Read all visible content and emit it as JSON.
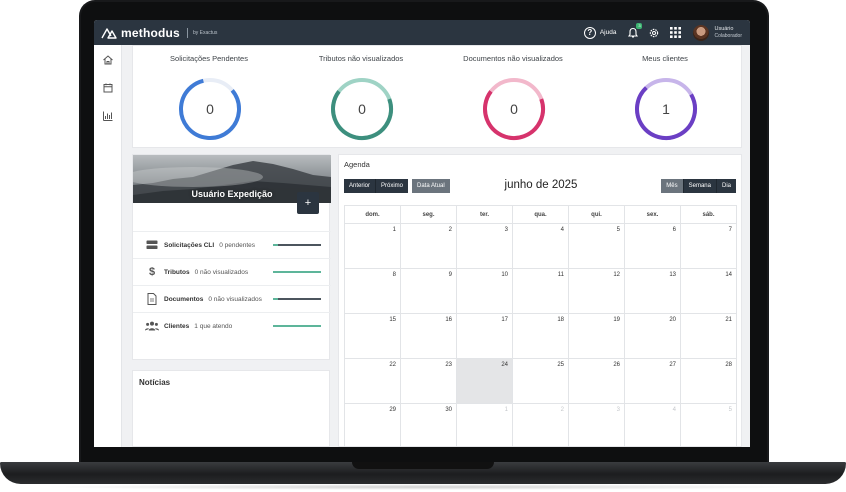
{
  "app": {
    "brand": "methodus",
    "brand_by": "by Exactus",
    "help_label": "Ajuda",
    "notification_count": "3",
    "user_name": "Usuário",
    "user_role": "Colaborador"
  },
  "stats": [
    {
      "title": "Solicitações Pendentes",
      "value": "0",
      "color": "#3f7bd6"
    },
    {
      "title": "Tributos não visualizados",
      "value": "0",
      "color": "#3d8f7e"
    },
    {
      "title": "Documentos não visualizados",
      "value": "0",
      "color": "#d6336c"
    },
    {
      "title": "Meus clientes",
      "value": "1",
      "color": "#6b3fc4"
    }
  ],
  "profile": {
    "name": "Usuário Expedição",
    "plus_label": "+",
    "rows": [
      {
        "label": "Solicitações CLI",
        "count": "0 pendentes",
        "icon": "server-icon",
        "progress": 0.1
      },
      {
        "label": "Tributos",
        "count": "0 não visualizados",
        "icon": "dollar-icon",
        "progress": 1.0
      },
      {
        "label": "Documentos",
        "count": "0 não visualizados",
        "icon": "document-icon",
        "progress": 0.1
      },
      {
        "label": "Clientes",
        "count": "1 que atendo",
        "icon": "users-icon",
        "progress": 1.0
      }
    ]
  },
  "news": {
    "title": "Notícias"
  },
  "agenda": {
    "title": "Agenda",
    "prev_label": "Anterior",
    "next_label": "Próximo",
    "today_label": "Data Atual",
    "month_title": "junho de 2025",
    "view_month": "Mês",
    "view_week": "Semana",
    "view_day": "Dia",
    "weekdays": [
      "dom.",
      "seg.",
      "ter.",
      "qua.",
      "qui.",
      "sex.",
      "sáb."
    ],
    "weeks": [
      [
        {
          "d": "1"
        },
        {
          "d": "2"
        },
        {
          "d": "3"
        },
        {
          "d": "4"
        },
        {
          "d": "5"
        },
        {
          "d": "6"
        },
        {
          "d": "7"
        }
      ],
      [
        {
          "d": "8"
        },
        {
          "d": "9"
        },
        {
          "d": "10"
        },
        {
          "d": "11"
        },
        {
          "d": "12"
        },
        {
          "d": "13"
        },
        {
          "d": "14"
        }
      ],
      [
        {
          "d": "15"
        },
        {
          "d": "16"
        },
        {
          "d": "17"
        },
        {
          "d": "18"
        },
        {
          "d": "19"
        },
        {
          "d": "20"
        },
        {
          "d": "21"
        }
      ],
      [
        {
          "d": "22"
        },
        {
          "d": "23"
        },
        {
          "d": "24",
          "today": true
        },
        {
          "d": "25"
        },
        {
          "d": "26"
        },
        {
          "d": "27"
        },
        {
          "d": "28"
        }
      ],
      [
        {
          "d": "29"
        },
        {
          "d": "30"
        },
        {
          "d": "1",
          "other": true
        },
        {
          "d": "2",
          "other": true
        },
        {
          "d": "3",
          "other": true
        },
        {
          "d": "4",
          "other": true
        },
        {
          "d": "5",
          "other": true
        }
      ]
    ]
  }
}
